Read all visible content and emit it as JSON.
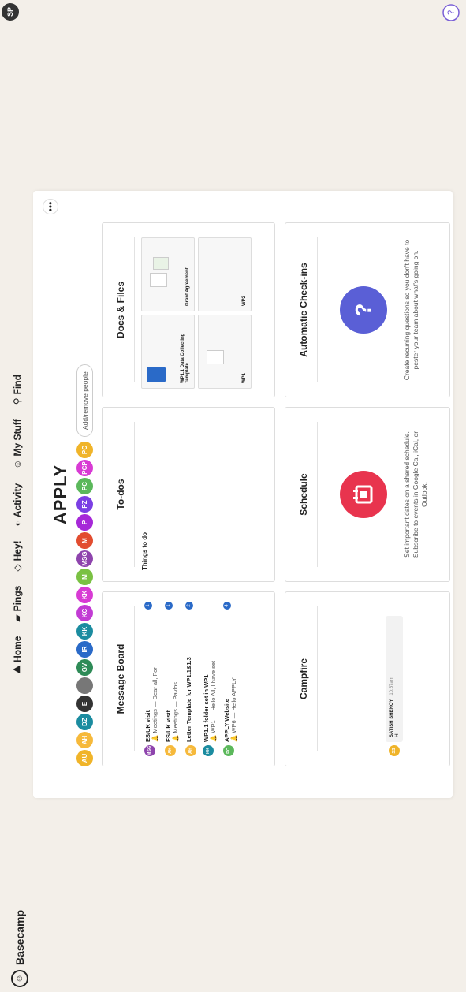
{
  "nav": {
    "brand": "Basecamp",
    "menu": [
      {
        "icon": "⛰",
        "label": "Home"
      },
      {
        "icon": "▰",
        "label": "Pings"
      },
      {
        "icon": "◇",
        "label": "Hey!"
      },
      {
        "icon": "◐",
        "label": "Activity"
      },
      {
        "icon": "☺",
        "label": "My Stuff"
      },
      {
        "icon": "⚲",
        "label": "Find"
      }
    ],
    "me": "SP",
    "help": "?"
  },
  "project": {
    "title": "APPLY",
    "more": "•••",
    "people": [
      {
        "initials": "AU",
        "color": "#f0b429"
      },
      {
        "initials": "AH",
        "color": "#f6b93b"
      },
      {
        "initials": "DZ",
        "color": "#1b8ca0"
      },
      {
        "initials": "E",
        "color": "#333333"
      },
      {
        "initials": "",
        "color": "#777777"
      },
      {
        "initials": "GV",
        "color": "#2e8b57"
      },
      {
        "initials": "IR",
        "color": "#2a6ac8"
      },
      {
        "initials": "KK",
        "color": "#1b8ca0"
      },
      {
        "initials": "KC",
        "color": "#c23bd4"
      },
      {
        "initials": "KK",
        "color": "#d83bd4"
      },
      {
        "initials": "M",
        "color": "#7ac143"
      },
      {
        "initials": "MSG",
        "color": "#8e44ad"
      },
      {
        "initials": "M",
        "color": "#e24c2f"
      },
      {
        "initials": "P",
        "color": "#a628d8"
      },
      {
        "initials": "PZ",
        "color": "#7b3fe4"
      },
      {
        "initials": "PC",
        "color": "#5bb85b"
      },
      {
        "initials": "PCP",
        "color": "#d83bd4"
      },
      {
        "initials": "PC",
        "color": "#f0b429"
      }
    ],
    "add_people": "Add/remove people"
  },
  "message_board": {
    "title": "Message Board",
    "messages": [
      {
        "initials": "MSG",
        "color": "#8e44ad",
        "title": "ES/UK visit",
        "excerpt": "🔔 Meetings — Dear all, For",
        "count": "1"
      },
      {
        "initials": "AH",
        "color": "#f6b93b",
        "title": "ES/UK visit",
        "excerpt": "🔔 Meetings — Pavlos",
        "count": "1"
      },
      {
        "initials": "AH",
        "color": "#f6b93b",
        "title": "Letter Template for WP1.1&1.3",
        "excerpt": "",
        "count": "2"
      },
      {
        "initials": "KK",
        "color": "#1b8ca0",
        "title": "WP1.1 folder set in WP1",
        "excerpt": "🔔 WP1 — Hello All, I have set",
        "count": ""
      },
      {
        "initials": "PC",
        "color": "#5bb85b",
        "title": "APPLY Website",
        "excerpt": "🔔 WP6 — Hello APPLY",
        "count": "4"
      }
    ]
  },
  "todos": {
    "title": "To-dos",
    "list_title": "Things to do"
  },
  "docs": {
    "title": "Docs & Files",
    "tiles": [
      {
        "name": "WP1.1 Data Collecting Template..."
      },
      {
        "name": "Grant Agreement"
      },
      {
        "name": "WP1"
      },
      {
        "name": "WP2"
      }
    ]
  },
  "campfire": {
    "title": "Campfire",
    "author": "SATISH SHENOY",
    "time": "10:57am",
    "initials": "SS",
    "message": "Hi"
  },
  "schedule": {
    "title": "Schedule",
    "blurb": "Set important dates on a shared schedule. Subscribe to events in Google Cal, iCal, or Outlook."
  },
  "checkins": {
    "title": "Automatic Check-ins",
    "blurb": "Create recurring questions so you don't have to pester your team about what's going on."
  },
  "colors": {
    "schedule_icon": "#e8344e",
    "checkins_icon": "#5a5fd6",
    "badge": "#2a6ac8"
  }
}
